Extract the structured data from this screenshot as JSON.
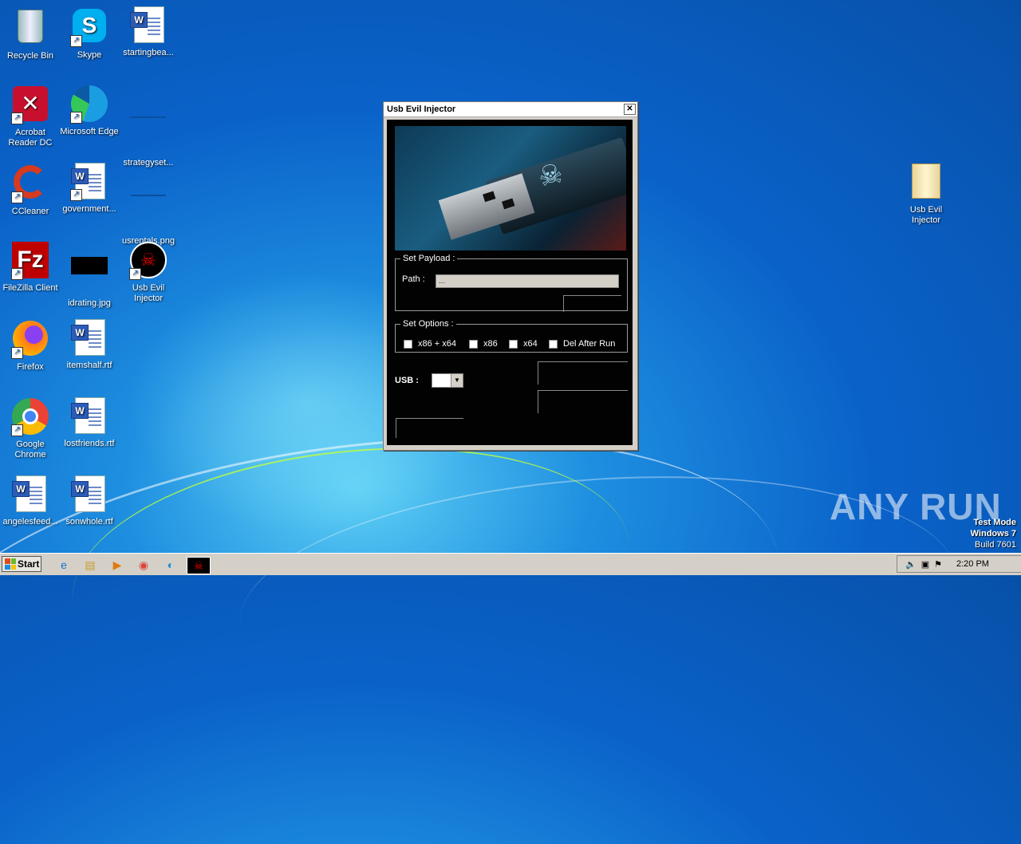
{
  "desktop": {
    "icons": [
      {
        "label": "Recycle Bin"
      },
      {
        "label": "Skype"
      },
      {
        "label": "startingbea..."
      },
      {
        "label": "Acrobat Reader DC"
      },
      {
        "label": "Microsoft Edge"
      },
      {
        "label": "strategyset..."
      },
      {
        "label": "CCleaner"
      },
      {
        "label": "government..."
      },
      {
        "label": "usrentals.png"
      },
      {
        "label": "FileZilla Client"
      },
      {
        "label": "idrating.jpg"
      },
      {
        "label": "Usb Evil Injector"
      },
      {
        "label": "Firefox"
      },
      {
        "label": "itemshalf.rtf"
      },
      {
        "label": "Google Chrome"
      },
      {
        "label": "lostfriends.rtf"
      },
      {
        "label": "angelesfeed..."
      },
      {
        "label": "sonwhole.rtf"
      },
      {
        "label": "Usb Evil Injector"
      }
    ],
    "watermark": "ANY RUN",
    "test_mode": [
      "Test Mode",
      "Windows 7",
      "Build 7601"
    ]
  },
  "dialog": {
    "title": "Usb Evil Injector",
    "close_glyph": "✕",
    "payload_group": "Set Payload :",
    "path_label": "Path :",
    "path_value": "...",
    "options_group": "Set Options :",
    "options": [
      {
        "label": "x86 + x64",
        "checked": false
      },
      {
        "label": "x86",
        "checked": false
      },
      {
        "label": "x64",
        "checked": false
      },
      {
        "label": "Del After Run",
        "checked": false
      }
    ],
    "usb_label": "USB :",
    "usb_value": ""
  },
  "taskbar": {
    "start_label": "Start",
    "clock": "2:20 PM",
    "pinned": [
      "ie-icon",
      "explorer-icon",
      "media-player-icon",
      "chrome-icon",
      "edge-icon",
      "usb-evil-injector-icon"
    ]
  }
}
